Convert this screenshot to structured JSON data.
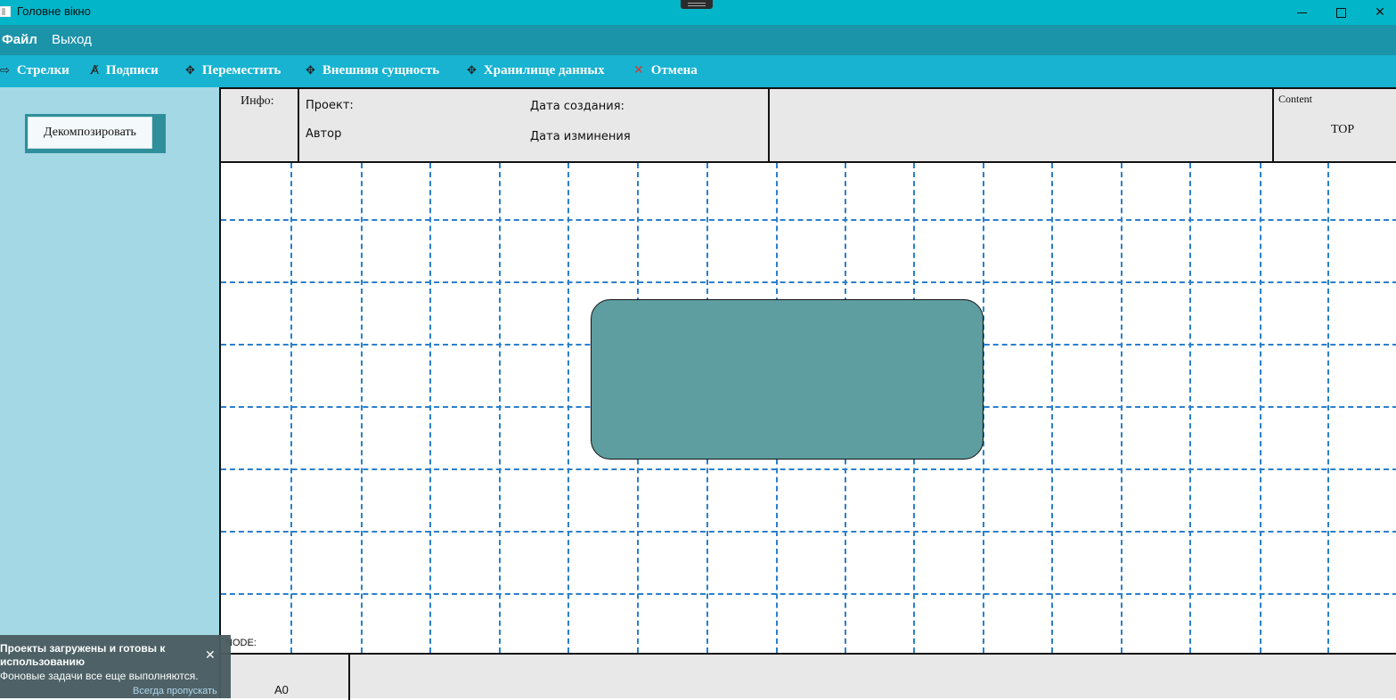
{
  "window": {
    "title": "Головне вікно",
    "icons": {
      "minimize": "minimize-icon",
      "maximize": "maximize-icon",
      "close": "close-icon"
    }
  },
  "menu": {
    "file": "Файл",
    "exit": "Выход"
  },
  "toolbar": {
    "arrows": {
      "label": "Стрелки",
      "icon": "arrow-icon"
    },
    "captions": {
      "label": "Подписи",
      "icon": "text-caption-icon"
    },
    "move": {
      "label": "Переместить",
      "icon": "move-icon"
    },
    "external_entity": {
      "label": "Внешняя сущность",
      "icon": "move-icon"
    },
    "data_store": {
      "label": "Хранилище данных",
      "icon": "move-icon"
    },
    "cancel": {
      "label": "Отмена",
      "icon": "cancel-x-icon"
    }
  },
  "sidebar": {
    "decompose_button": "Декомпозировать"
  },
  "header": {
    "info_label": "Инфо:",
    "project_label": "Проект:",
    "author_label": "Автор",
    "created_label": "Дата создания:",
    "modified_label": "Дата изминения",
    "content_label": "Content",
    "content_value": "TOP"
  },
  "canvas": {
    "node_label": "NODE:",
    "colors": {
      "grid": "#2b7fcc",
      "box": "#5f9ea0"
    }
  },
  "footer": {
    "node_code": "A0"
  },
  "notification": {
    "title": "Проекты загружены и готовы к использованию",
    "body": "Фоновые задачи все еще выполняются.",
    "action": "Всегда пропускать"
  }
}
